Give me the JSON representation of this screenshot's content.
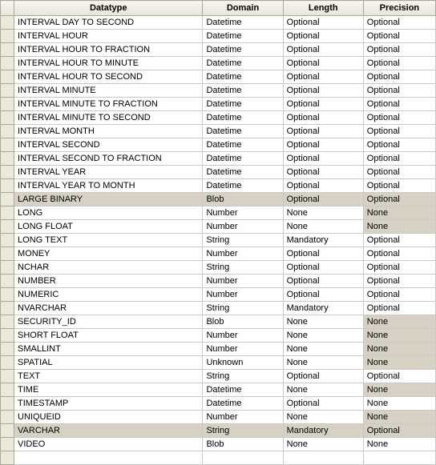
{
  "columns": {
    "datatype": "Datatype",
    "domain": "Domain",
    "length": "Length",
    "precision": "Precision"
  },
  "rows": [
    {
      "datatype": "INTERVAL DAY TO SECOND",
      "domain": "Datetime",
      "length": "Optional",
      "precision": "Optional",
      "shaded": []
    },
    {
      "datatype": "INTERVAL HOUR",
      "domain": "Datetime",
      "length": "Optional",
      "precision": "Optional",
      "shaded": []
    },
    {
      "datatype": "INTERVAL HOUR TO FRACTION",
      "domain": "Datetime",
      "length": "Optional",
      "precision": "Optional",
      "shaded": []
    },
    {
      "datatype": "INTERVAL HOUR TO MINUTE",
      "domain": "Datetime",
      "length": "Optional",
      "precision": "Optional",
      "shaded": []
    },
    {
      "datatype": "INTERVAL HOUR TO SECOND",
      "domain": "Datetime",
      "length": "Optional",
      "precision": "Optional",
      "shaded": []
    },
    {
      "datatype": "INTERVAL MINUTE",
      "domain": "Datetime",
      "length": "Optional",
      "precision": "Optional",
      "shaded": []
    },
    {
      "datatype": "INTERVAL MINUTE TO FRACTION",
      "domain": "Datetime",
      "length": "Optional",
      "precision": "Optional",
      "shaded": []
    },
    {
      "datatype": "INTERVAL MINUTE TO SECOND",
      "domain": "Datetime",
      "length": "Optional",
      "precision": "Optional",
      "shaded": []
    },
    {
      "datatype": "INTERVAL MONTH",
      "domain": "Datetime",
      "length": "Optional",
      "precision": "Optional",
      "shaded": []
    },
    {
      "datatype": "INTERVAL SECOND",
      "domain": "Datetime",
      "length": "Optional",
      "precision": "Optional",
      "shaded": []
    },
    {
      "datatype": "INTERVAL SECOND TO FRACTION",
      "domain": "Datetime",
      "length": "Optional",
      "precision": "Optional",
      "shaded": []
    },
    {
      "datatype": "INTERVAL YEAR",
      "domain": "Datetime",
      "length": "Optional",
      "precision": "Optional",
      "shaded": []
    },
    {
      "datatype": "INTERVAL YEAR TO MONTH",
      "domain": "Datetime",
      "length": "Optional",
      "precision": "Optional",
      "shaded": []
    },
    {
      "datatype": "LARGE BINARY",
      "domain": "Blob",
      "length": "Optional",
      "precision": "Optional",
      "shaded": [
        0,
        1,
        2,
        3
      ]
    },
    {
      "datatype": "LONG",
      "domain": "Number",
      "length": "None",
      "precision": "None",
      "shaded": [
        3
      ]
    },
    {
      "datatype": "LONG FLOAT",
      "domain": "Number",
      "length": "None",
      "precision": "None",
      "shaded": [
        3
      ]
    },
    {
      "datatype": "LONG TEXT",
      "domain": "String",
      "length": "Mandatory",
      "precision": "Optional",
      "shaded": []
    },
    {
      "datatype": "MONEY",
      "domain": "Number",
      "length": "Optional",
      "precision": "Optional",
      "shaded": []
    },
    {
      "datatype": "NCHAR",
      "domain": "String",
      "length": "Optional",
      "precision": "Optional",
      "shaded": []
    },
    {
      "datatype": "NUMBER",
      "domain": "Number",
      "length": "Optional",
      "precision": "Optional",
      "shaded": []
    },
    {
      "datatype": "NUMERIC",
      "domain": "Number",
      "length": "Optional",
      "precision": "Optional",
      "shaded": []
    },
    {
      "datatype": "NVARCHAR",
      "domain": "String",
      "length": "Mandatory",
      "precision": "Optional",
      "shaded": []
    },
    {
      "datatype": "SECURITY_ID",
      "domain": "Blob",
      "length": "None",
      "precision": "None",
      "shaded": [
        3
      ]
    },
    {
      "datatype": "SHORT FLOAT",
      "domain": "Number",
      "length": "None",
      "precision": "None",
      "shaded": [
        3
      ]
    },
    {
      "datatype": "SMALLINT",
      "domain": "Number",
      "length": "None",
      "precision": "None",
      "shaded": [
        3
      ]
    },
    {
      "datatype": "SPATIAL",
      "domain": "Unknown",
      "length": "None",
      "precision": "None",
      "shaded": [
        3
      ]
    },
    {
      "datatype": "TEXT",
      "domain": "String",
      "length": "Optional",
      "precision": "Optional",
      "shaded": []
    },
    {
      "datatype": "TIME",
      "domain": "Datetime",
      "length": "None",
      "precision": "None",
      "shaded": [
        3
      ]
    },
    {
      "datatype": "TIMESTAMP",
      "domain": "Datetime",
      "length": "Optional",
      "precision": "None",
      "shaded": []
    },
    {
      "datatype": "UNIQUEID",
      "domain": "Number",
      "length": "None",
      "precision": "None",
      "shaded": [
        3
      ]
    },
    {
      "datatype": "VARCHAR",
      "domain": "String",
      "length": "Mandatory",
      "precision": "Optional",
      "shaded": [
        0,
        1,
        2,
        3
      ]
    },
    {
      "datatype": "VIDEO",
      "domain": "Blob",
      "length": "None",
      "precision": "None",
      "shaded": []
    }
  ]
}
